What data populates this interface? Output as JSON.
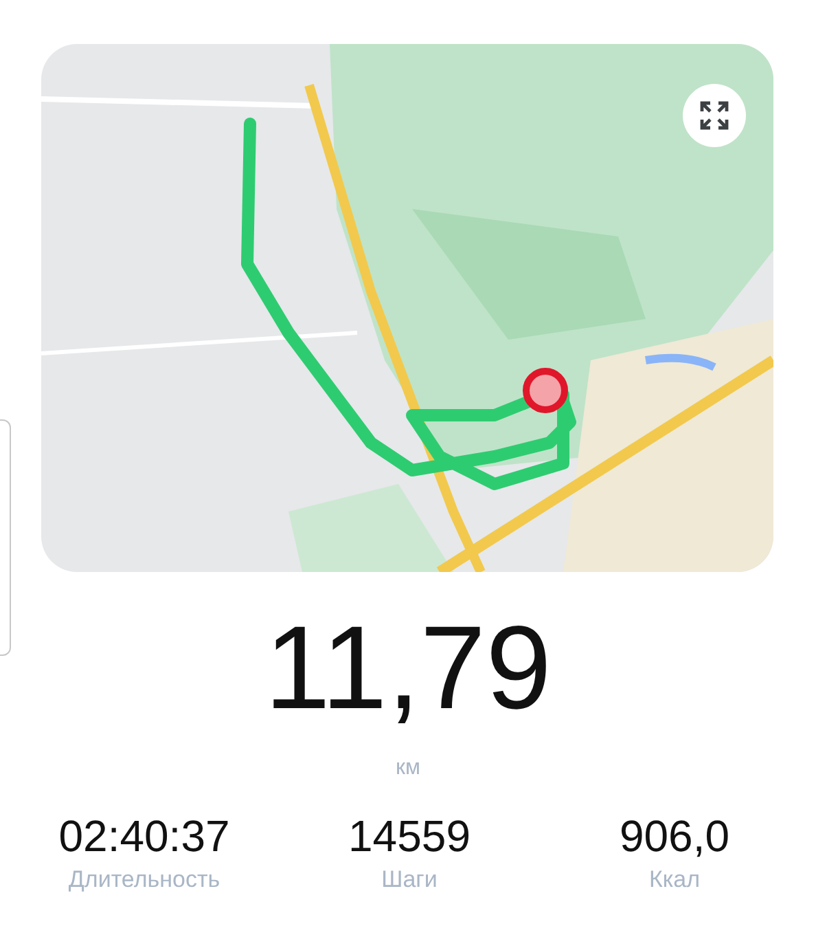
{
  "distance": {
    "value": "11,79",
    "unit": "км"
  },
  "stats": [
    {
      "value": "02:40:37",
      "label": "Длительность"
    },
    {
      "value": "14559",
      "label": "Шаги"
    },
    {
      "value": "906,0",
      "label": "Ккал"
    }
  ]
}
